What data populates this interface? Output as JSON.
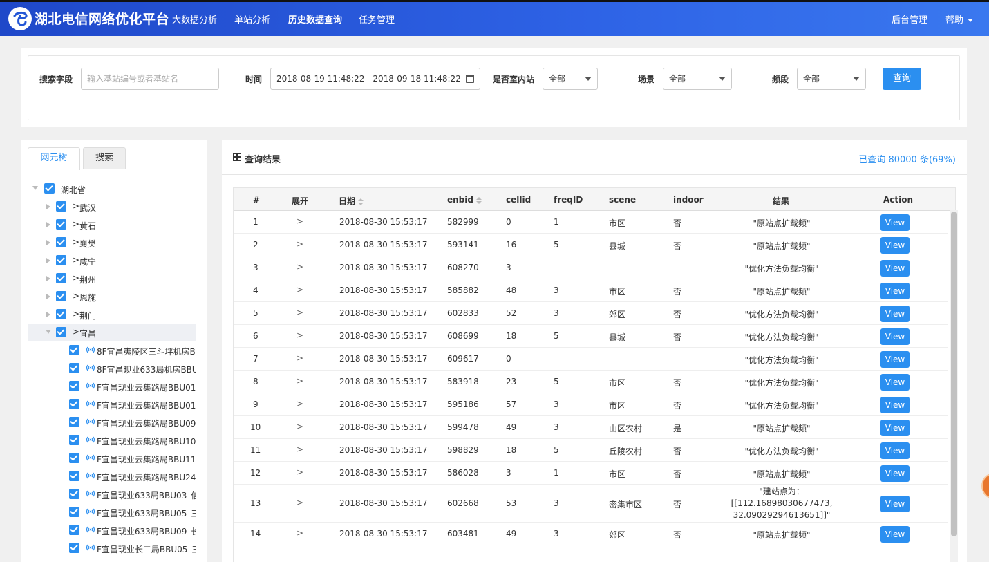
{
  "header": {
    "brand": "湖北电信网络优化平台",
    "nav": [
      "大数据分析",
      "单站分析",
      "历史数据查询",
      "任务管理"
    ],
    "active_nav": "历史数据查询",
    "right": {
      "admin": "后台管理",
      "help": "帮助"
    }
  },
  "search": {
    "field_label": "搜索字段",
    "field_placeholder": "输入基站编号或者基站名",
    "time_label": "时间",
    "time_value": "2018-08-19 11:48:22 - 2018-09-18 11:48:22",
    "indoor_label": "是否室内站",
    "indoor_value": "全部",
    "scene_label": "场景",
    "scene_value": "全部",
    "freq_label": "频段",
    "freq_value": "全部",
    "query_button": "查询"
  },
  "tree": {
    "tabs": [
      "网元树",
      "搜索"
    ],
    "root": "湖北省",
    "cities": [
      "武汉",
      "黄石",
      "襄樊",
      "咸宁",
      "荆州",
      "恩施",
      "荆门",
      "宜昌"
    ],
    "sites": [
      "8F宜昌夷陵区三斗坪机房B",
      "8F宜昌现业633局机房BBU",
      "F宜昌现业云集路局BBU01",
      "F宜昌现业云集路局BBU01",
      "F宜昌现业云集路局BBU09",
      "F宜昌现业云集路局BBU10",
      "F宜昌现业云集路局BBU11_",
      "F宜昌现业云集路局BBU24",
      "F宜昌现业633局BBU03_信",
      "F宜昌现业633局BBU05_三",
      "F宜昌现业633局BBU09_长",
      "F宜昌现业长二局BBU05_三"
    ]
  },
  "results": {
    "title": "查询结果",
    "count_text": "已查询 80000 条(69%)",
    "columns": [
      "#",
      "展开",
      "日期",
      "enbid",
      "cellid",
      "freqID",
      "scene",
      "indoor",
      "结果",
      "Action"
    ],
    "view_label": "View",
    "expand_glyph": ">",
    "rows": [
      {
        "n": "1",
        "date": "2018-08-30 15:53:17",
        "enbid": "582999",
        "cellid": "0",
        "freq": "1",
        "scene": "市区",
        "indoor": "否",
        "result": "\"原站点扩载频\""
      },
      {
        "n": "2",
        "date": "2018-08-30 15:53:17",
        "enbid": "593141",
        "cellid": "16",
        "freq": "5",
        "scene": "县城",
        "indoor": "否",
        "result": "\"原站点扩载频\""
      },
      {
        "n": "3",
        "date": "2018-08-30 15:53:17",
        "enbid": "608270",
        "cellid": "3",
        "freq": "",
        "scene": "",
        "indoor": "",
        "result": "\"优化方法负载均衡\""
      },
      {
        "n": "4",
        "date": "2018-08-30 15:53:17",
        "enbid": "585882",
        "cellid": "48",
        "freq": "3",
        "scene": "市区",
        "indoor": "否",
        "result": "\"原站点扩载频\""
      },
      {
        "n": "5",
        "date": "2018-08-30 15:53:17",
        "enbid": "602833",
        "cellid": "52",
        "freq": "3",
        "scene": "郊区",
        "indoor": "否",
        "result": "\"优化方法负载均衡\""
      },
      {
        "n": "6",
        "date": "2018-08-30 15:53:17",
        "enbid": "608699",
        "cellid": "18",
        "freq": "5",
        "scene": "县城",
        "indoor": "否",
        "result": "\"优化方法负载均衡\""
      },
      {
        "n": "7",
        "date": "2018-08-30 15:53:17",
        "enbid": "609617",
        "cellid": "0",
        "freq": "",
        "scene": "",
        "indoor": "",
        "result": "\"优化方法负载均衡\""
      },
      {
        "n": "8",
        "date": "2018-08-30 15:53:17",
        "enbid": "583918",
        "cellid": "23",
        "freq": "5",
        "scene": "市区",
        "indoor": "否",
        "result": "\"优化方法负载均衡\""
      },
      {
        "n": "9",
        "date": "2018-08-30 15:53:17",
        "enbid": "595186",
        "cellid": "57",
        "freq": "3",
        "scene": "市区",
        "indoor": "否",
        "result": "\"优化方法负载均衡\""
      },
      {
        "n": "10",
        "date": "2018-08-30 15:53:17",
        "enbid": "599478",
        "cellid": "49",
        "freq": "3",
        "scene": "山区农村",
        "indoor": "是",
        "result": "\"原站点扩载频\""
      },
      {
        "n": "11",
        "date": "2018-08-30 15:53:17",
        "enbid": "598829",
        "cellid": "18",
        "freq": "5",
        "scene": "丘陵农村",
        "indoor": "否",
        "result": "\"优化方法负载均衡\""
      },
      {
        "n": "12",
        "date": "2018-08-30 15:53:17",
        "enbid": "586028",
        "cellid": "3",
        "freq": "1",
        "scene": "市区",
        "indoor": "否",
        "result": "\"原站点扩载频\""
      },
      {
        "n": "13",
        "date": "2018-08-30 15:53:17",
        "enbid": "602668",
        "cellid": "53",
        "freq": "3",
        "scene": "密集市区",
        "indoor": "否",
        "result": "\"建站点为：[[112.16898030677473, 32.09029294613651]]\""
      },
      {
        "n": "14",
        "date": "2018-08-30 15:53:17",
        "enbid": "603481",
        "cellid": "49",
        "freq": "3",
        "scene": "郊区",
        "indoor": "否",
        "result": "\"原站点扩载频\""
      }
    ]
  },
  "colors": {
    "primary": "#2b8ff0",
    "header_start": "#1f48c9",
    "header_end": "#3a78ef"
  }
}
